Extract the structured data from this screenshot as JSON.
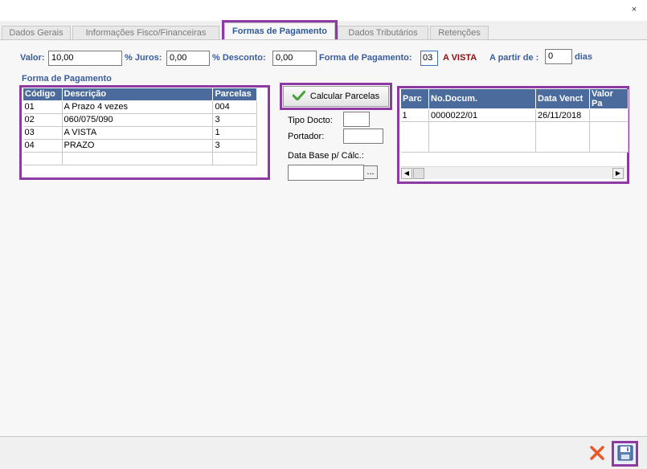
{
  "window": {
    "close_symbol": "×"
  },
  "tabs": [
    {
      "label": "Dados Gerais"
    },
    {
      "label": "Informações Fisco/Financeiras"
    },
    {
      "label": "Formas de Pagamento"
    },
    {
      "label": "Dados Tributários"
    },
    {
      "label": "Retenções"
    }
  ],
  "form": {
    "valor_label": "Valor:",
    "valor_value": "10,00",
    "juros_label": "% Juros:",
    "juros_value": "0,00",
    "desconto_label": "% Desconto:",
    "desconto_value": "0,00",
    "forma_label": "Forma de Pagamento:",
    "forma_value": "03",
    "forma_desc": "A VISTA",
    "apartir_label": "A partir de :",
    "apartir_value": "0",
    "dias_label": "dias"
  },
  "payment_table": {
    "title": "Forma de Pagamento",
    "headers": [
      "Código",
      "Descrição",
      "Parcelas"
    ],
    "rows": [
      [
        "01",
        "A Prazo 4 vezes",
        "004"
      ],
      [
        "02",
        "060/075/090",
        "3"
      ],
      [
        "03",
        "A VISTA",
        "1"
      ],
      [
        "04",
        "PRAZO",
        "3"
      ]
    ]
  },
  "calc": {
    "button_label": "Calcular Parcelas",
    "tipo_docto_label": "Tipo Docto:",
    "tipo_docto_value": "",
    "portador_label": "Portador:",
    "portador_value": "",
    "data_base_label": "Data Base p/ Cálc.:",
    "data_base_value": "",
    "ellipsis_label": "..."
  },
  "installments_table": {
    "headers": [
      "Parc",
      "No.Docum.",
      "Data Venct",
      "Valor Pa"
    ],
    "rows": [
      [
        "1",
        "0000022/01",
        "26/11/2018",
        ""
      ]
    ]
  },
  "footer": {
    "cancel_icon": "cancel-icon",
    "save_icon": "save-icon"
  },
  "colors": {
    "highlight": "#8e3aa3",
    "label_blue": "#3a5d9c",
    "grid_header": "#4a6b9c",
    "accent_red": "#8a1010"
  }
}
